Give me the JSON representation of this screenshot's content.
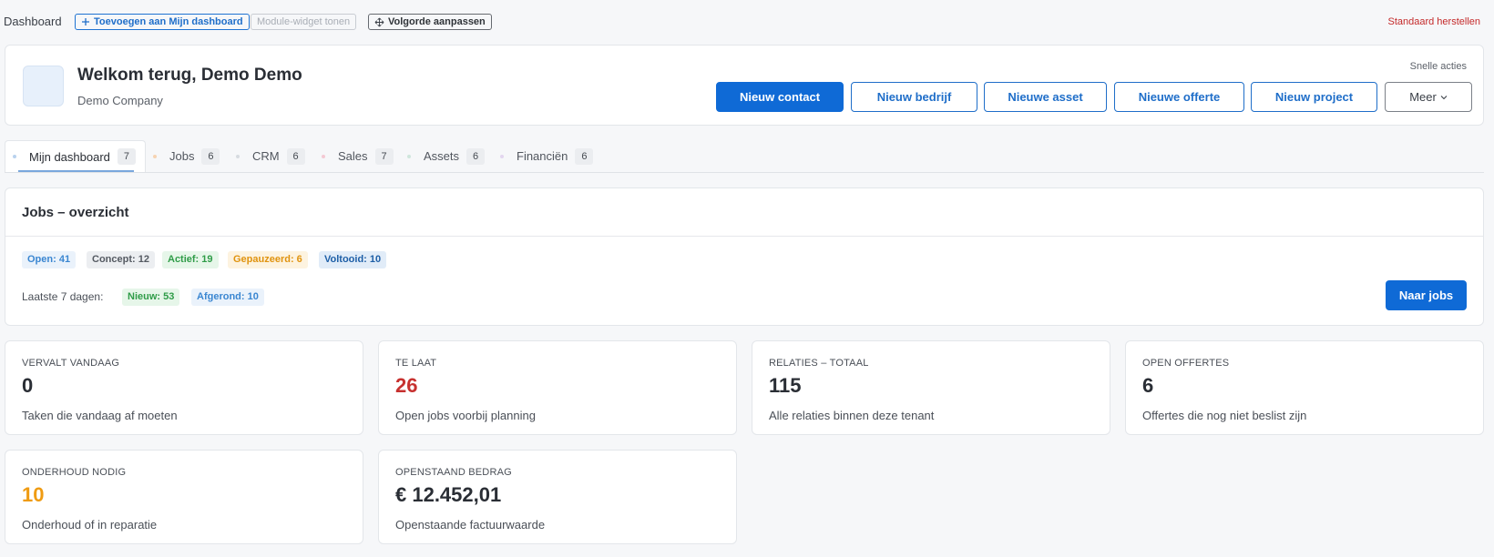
{
  "topbar": {
    "breadcrumb": "Dashboard",
    "add_label": "Toevoegen aan Mijn dashboard",
    "module_label": "Module-widget tonen",
    "order_label": "Volgorde aanpassen",
    "reset_label": "Standaard herstellen"
  },
  "welcome": {
    "title": "Welkom terug, Demo Demo",
    "company": "Demo Company",
    "quick_actions_label": "Snelle acties",
    "actions": [
      {
        "label": "Nieuw contact"
      },
      {
        "label": "Nieuw bedrijf"
      },
      {
        "label": "Nieuwe asset"
      },
      {
        "label": "Nieuwe offerte"
      },
      {
        "label": "Nieuw project"
      },
      {
        "label": "Meer"
      }
    ]
  },
  "tabs": [
    {
      "label": "Mijn dashboard",
      "count": "7",
      "dot_color": "#b9d2ee"
    },
    {
      "label": "Jobs",
      "count": "6",
      "dot_color": "#f6d3b2"
    },
    {
      "label": "CRM",
      "count": "6",
      "dot_color": "#d7dbe0"
    },
    {
      "label": "Sales",
      "count": "7",
      "dot_color": "#f4c9d3"
    },
    {
      "label": "Assets",
      "count": "6",
      "dot_color": "#cfe6dc"
    },
    {
      "label": "Financiën",
      "count": "6",
      "dot_color": "#e3d6ef"
    }
  ],
  "jobs": {
    "title": "Jobs – overzicht",
    "status": {
      "open": "Open: 41",
      "concept": "Concept: 12",
      "actief": "Actief: 19",
      "gepauzeerd": "Gepauzeerd: 6",
      "voltooid": "Voltooid: 10"
    },
    "last7_label": "Laatste 7 dagen:",
    "nieuw": "Nieuw: 53",
    "afgerond": "Afgerond: 10",
    "button": "Naar jobs"
  },
  "stats": [
    {
      "label": "VERVALT VANDAAG",
      "value": "0",
      "desc": "Taken die vandaag af moeten"
    },
    {
      "label": "TE LAAT",
      "value": "26",
      "desc": "Open jobs voorbij planning"
    },
    {
      "label": "RELATIES – TOTAAL",
      "value": "115",
      "desc": "Alle relaties binnen deze tenant"
    },
    {
      "label": "OPEN OFFERTES",
      "value": "6",
      "desc": "Offertes die nog niet beslist zijn"
    },
    {
      "label": "ONDERHOUD NODIG",
      "value": "10",
      "desc": "Onderhoud of in reparatie"
    },
    {
      "label": "OPENSTAAND BEDRAG",
      "value": "€ 12.452,01",
      "desc": "Openstaande factuurwaarde"
    }
  ],
  "colors": {
    "primary": "#0f6ad6",
    "danger": "#c7312f",
    "warning": "#ef9b12"
  },
  "icons": [
    "plus-icon",
    "move-icon",
    "chevron-down-icon"
  ]
}
